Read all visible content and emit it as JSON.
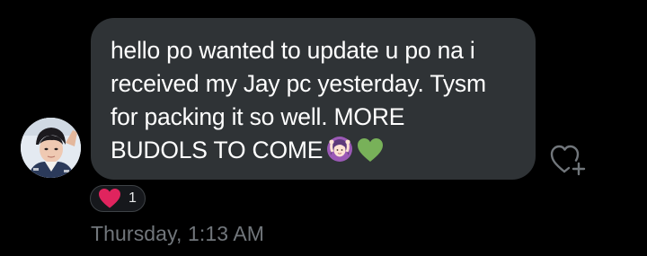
{
  "message": {
    "lines": [
      "hello po wanted to update u po na i",
      "received my Jay pc yesterday. Tysm",
      "for packing it so well. MORE",
      "BUDOLS TO COME"
    ],
    "emojis": [
      "woman-gesturing-ok-emoji",
      "green-heart-emoji"
    ]
  },
  "reactions": {
    "emoji": "red-heart-emoji",
    "count": "1"
  },
  "timestamp": "Thursday, 1:13 AM",
  "add_reaction_icon": "heart-plus-icon",
  "colors": {
    "background": "#000000",
    "bubble": "#2f3336",
    "message_text": "#ffffff",
    "timestamp_text": "#71767b",
    "reaction_border": "#3e4246",
    "red_heart": "#e0245e",
    "green_heart": "#78b159"
  }
}
